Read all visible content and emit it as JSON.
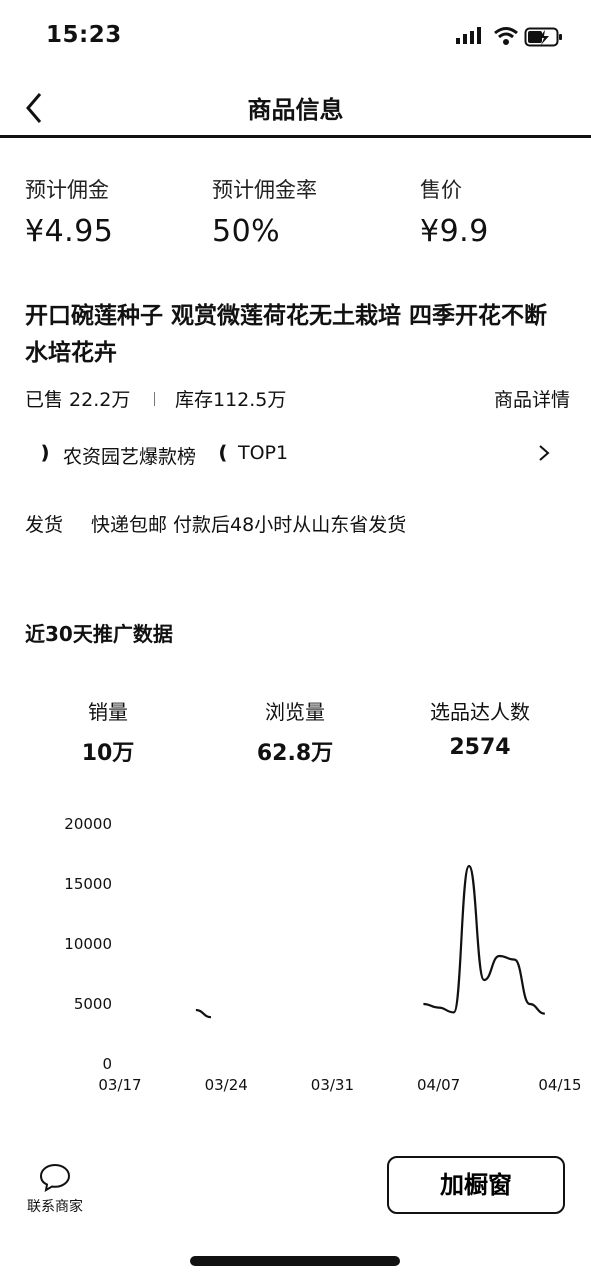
{
  "status_bar": {
    "time": "15:23"
  },
  "nav": {
    "title": "商品信息"
  },
  "metrics": [
    {
      "label": "预计佣金",
      "value": "¥4.95"
    },
    {
      "label": "预计佣金率",
      "value": "50%"
    },
    {
      "label": "售价",
      "value": "¥9.9"
    }
  ],
  "product": {
    "title": "开口碗莲种子 观赏微莲荷花无土栽培 四季开花不断 水培花卉",
    "sold": "已售 22.2万",
    "stock": "库存112.5万",
    "detail_link": "商品详情",
    "rank_text": "农资园艺爆款榜",
    "rank_value": "TOP1",
    "shipping_label": "发货",
    "shipping_text": "快递包邮 付款后48小时从山东省发货"
  },
  "promo": {
    "section_title": "近30天推广数据",
    "stats": [
      {
        "label": "销量",
        "value": "10万"
      },
      {
        "label": "浏览量",
        "value": "62.8万"
      },
      {
        "label": "选品达人数",
        "value": "2574"
      }
    ]
  },
  "chart_data": {
    "type": "line",
    "title": "",
    "xlabel": "",
    "ylabel": "",
    "ylim": [
      0,
      20000
    ],
    "y_ticks": [
      "20000",
      "15000",
      "10000",
      "5000",
      "0"
    ],
    "x_ticks": [
      "03/17",
      "03/24",
      "03/31",
      "04/07",
      "04/15"
    ],
    "grid": false,
    "series": [
      {
        "points": [
          {
            "x": "03/22",
            "y": 4500
          },
          {
            "x": "03/23",
            "y": 3900
          },
          {
            "x": "04/06",
            "y": 5000
          },
          {
            "x": "04/07",
            "y": 4700
          },
          {
            "x": "04/08",
            "y": 4300
          },
          {
            "x": "04/09",
            "y": 16500
          },
          {
            "x": "04/10",
            "y": 7000
          },
          {
            "x": "04/11",
            "y": 9000
          },
          {
            "x": "04/12",
            "y": 8700
          },
          {
            "x": "04/13",
            "y": 5000
          },
          {
            "x": "04/14",
            "y": 4200
          }
        ]
      }
    ]
  },
  "bottom": {
    "contact_label": "联系商家",
    "add_button": "加橱窗"
  },
  "icons": {
    "back": "chevron-left-icon",
    "rank_arrow": "chevron-right-icon",
    "contact": "chat-bubble-icon",
    "signal": "cellular-signal-icon",
    "wifi": "wifi-icon",
    "battery": "battery-charging-icon"
  }
}
